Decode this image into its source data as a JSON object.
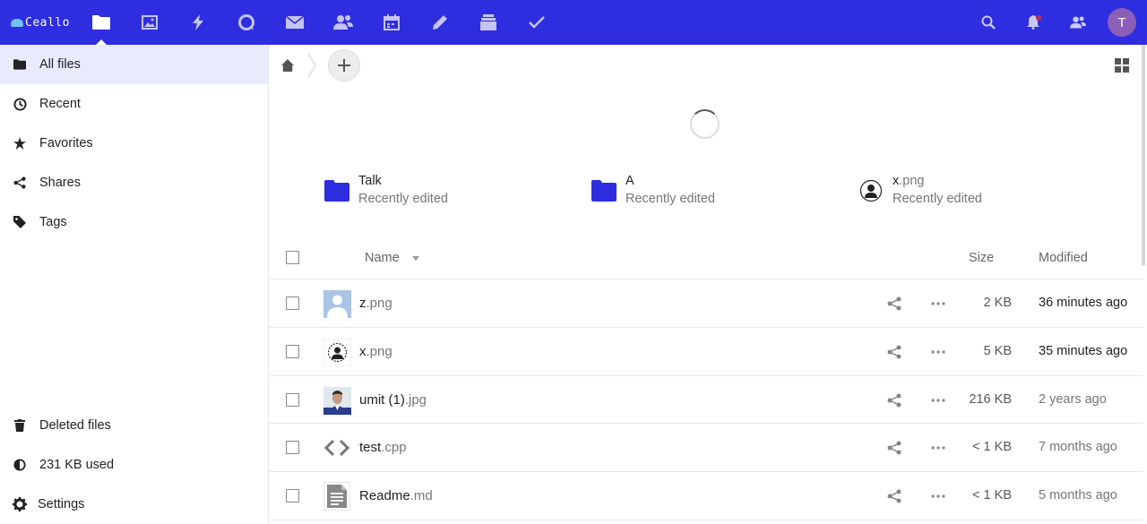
{
  "app": {
    "logo_text": "Ceallo",
    "accent": "#2e2de0",
    "avatar_initial": "T",
    "avatar_color": "#8a5fb5"
  },
  "topbar": {
    "apps": [
      {
        "name": "files",
        "icon": "folder-icon",
        "active": true
      },
      {
        "name": "photos",
        "icon": "image-icon"
      },
      {
        "name": "activity",
        "icon": "lightning-icon"
      },
      {
        "name": "talk",
        "icon": "chat-icon"
      },
      {
        "name": "mail",
        "icon": "mail-icon"
      },
      {
        "name": "contacts",
        "icon": "contacts-icon"
      },
      {
        "name": "calendar",
        "icon": "calendar-icon"
      },
      {
        "name": "notes",
        "icon": "pencil-icon"
      },
      {
        "name": "deck",
        "icon": "deck-icon"
      },
      {
        "name": "tasks",
        "icon": "checkmark-icon"
      }
    ],
    "right": [
      "search-icon",
      "notifications-icon",
      "contacts-menu-icon"
    ]
  },
  "sidebar": {
    "items": [
      {
        "label": "All files",
        "icon": "folder-icon"
      },
      {
        "label": "Recent",
        "icon": "clock-icon"
      },
      {
        "label": "Favorites",
        "icon": "star-icon"
      },
      {
        "label": "Shares",
        "icon": "share-icon"
      },
      {
        "label": "Tags",
        "icon": "tag-icon"
      }
    ],
    "bottom": [
      {
        "label": "Deleted files",
        "icon": "trash-icon"
      },
      {
        "label": "231 KB used",
        "icon": "quota-pie-icon"
      },
      {
        "label": "Settings",
        "icon": "gear-icon"
      }
    ]
  },
  "recent": [
    {
      "name": "Talk",
      "ext": "",
      "sub": "Recently edited",
      "icon": "folder-icon"
    },
    {
      "name": "A",
      "ext": "",
      "sub": "Recently edited",
      "icon": "folder-icon"
    },
    {
      "name": "x",
      "ext": ".png",
      "sub": "Recently edited",
      "icon": "avatar-image-icon"
    }
  ],
  "table": {
    "headers": {
      "name": "Name",
      "size": "Size",
      "modified": "Modified"
    },
    "rows": [
      {
        "name": "z",
        "ext": ".png",
        "size": "2 KB",
        "modified": "36 minutes ago",
        "thumb": "blank-avatar-thumb"
      },
      {
        "name": "x",
        "ext": ".png",
        "size": "5 KB",
        "modified": "35 minutes ago",
        "thumb": "avatar-image-icon"
      },
      {
        "name": "umit (1)",
        "ext": ".jpg",
        "size": "216 KB",
        "modified": "2 years ago",
        "thumb": "photo-thumb"
      },
      {
        "name": "test",
        "ext": ".cpp",
        "size": "< 1 KB",
        "modified": "7 months ago",
        "thumb": "code-icon"
      },
      {
        "name": "Readme",
        "ext": ".md",
        "size": "< 1 KB",
        "modified": "5 months ago",
        "thumb": "text-file-icon"
      }
    ]
  }
}
